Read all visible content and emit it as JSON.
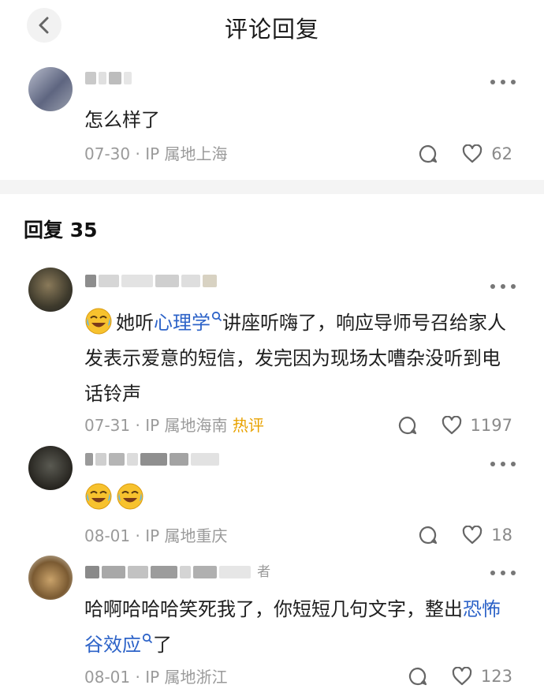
{
  "header": {
    "title": "评论回复"
  },
  "root_comment": {
    "text": "怎么样了",
    "date": "07-30",
    "location": "IP 属地上海",
    "likes": "62"
  },
  "replies_header": "回复 35",
  "replies": [
    {
      "segments": [
        "她听",
        "心理学",
        "讲座听嗨了，响应导师号召给家人发表示爱意的短信，发完因为现场太嘈杂没听到电话铃声"
      ],
      "date": "07-31",
      "location": "IP 属地海南",
      "badge": "热评",
      "likes": "1197"
    },
    {
      "date": "08-01",
      "location": "IP 属地重庆",
      "likes": "18"
    },
    {
      "name_suffix": "者",
      "segments": [
        "哈啊哈哈哈笑死我了，你短短几句文字，整出",
        "恐怖谷效应",
        "了"
      ],
      "date": "08-01",
      "location": "IP 属地浙江",
      "likes": "123"
    }
  ],
  "colors": {
    "link": "#2d63c8",
    "hot": "#e8a200",
    "meta": "#9a9a9a",
    "divider": "#f4f4f4"
  },
  "icons": [
    "chevron-left-icon",
    "more-dots-icon",
    "comment-bubble-icon",
    "heart-icon",
    "crying-laugh-emoji"
  ]
}
